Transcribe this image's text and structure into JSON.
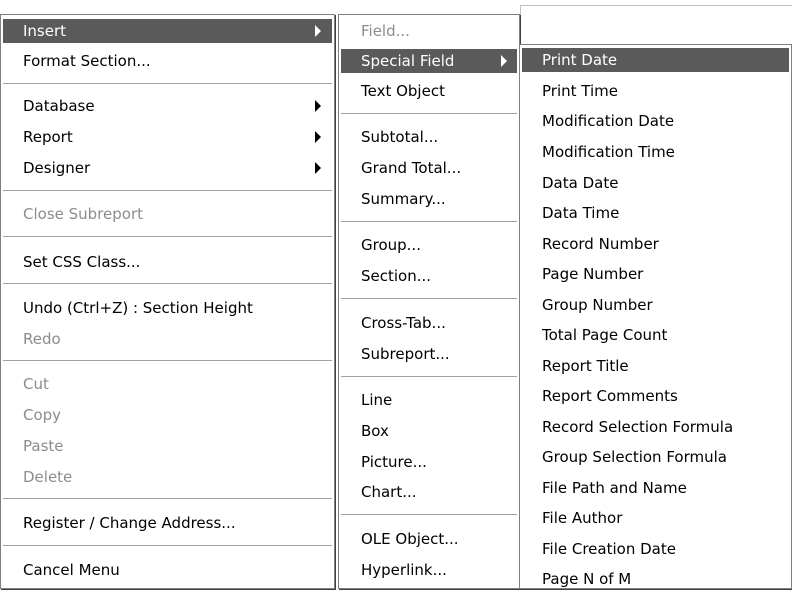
{
  "menu1": {
    "insert": "Insert",
    "format_section": "Format Section...",
    "database": "Database",
    "report": "Report",
    "designer": "Designer",
    "close_subreport": "Close Subreport",
    "set_css_class": "Set CSS Class...",
    "undo": "Undo (Ctrl+Z) : Section Height",
    "redo": "Redo",
    "cut": "Cut",
    "copy": "Copy",
    "paste": "Paste",
    "delete": "Delete",
    "register": "Register / Change Address...",
    "cancel": "Cancel Menu"
  },
  "menu2": {
    "field": "Field...",
    "special_field": "Special Field",
    "text_object": "Text Object",
    "subtotal": "Subtotal...",
    "grand_total": "Grand Total...",
    "summary": "Summary...",
    "group": "Group...",
    "section": "Section...",
    "cross_tab": "Cross-Tab...",
    "subreport": "Subreport...",
    "line": "Line",
    "box": "Box",
    "picture": "Picture...",
    "chart": "Chart...",
    "ole_object": "OLE Object...",
    "hyperlink": "Hyperlink..."
  },
  "menu3": {
    "print_date": "Print Date",
    "print_time": "Print Time",
    "modification_date": "Modification Date",
    "modification_time": "Modification Time",
    "data_date": "Data Date",
    "data_time": "Data Time",
    "record_number": "Record Number",
    "page_number": "Page Number",
    "group_number": "Group Number",
    "total_page_count": "Total Page Count",
    "report_title": "Report Title",
    "report_comments": "Report Comments",
    "record_selection_formula": "Record Selection Formula",
    "group_selection_formula": "Group Selection Formula",
    "file_path_and_name": "File Path and Name",
    "file_author": "File Author",
    "file_creation_date": "File Creation Date",
    "page_n_of_m": "Page N of M"
  },
  "colors": {
    "highlight": "#5a5a5a",
    "highlight_text": "#ffffff",
    "disabled_text": "#8c8c8c",
    "separator": "#a0a0a0"
  }
}
